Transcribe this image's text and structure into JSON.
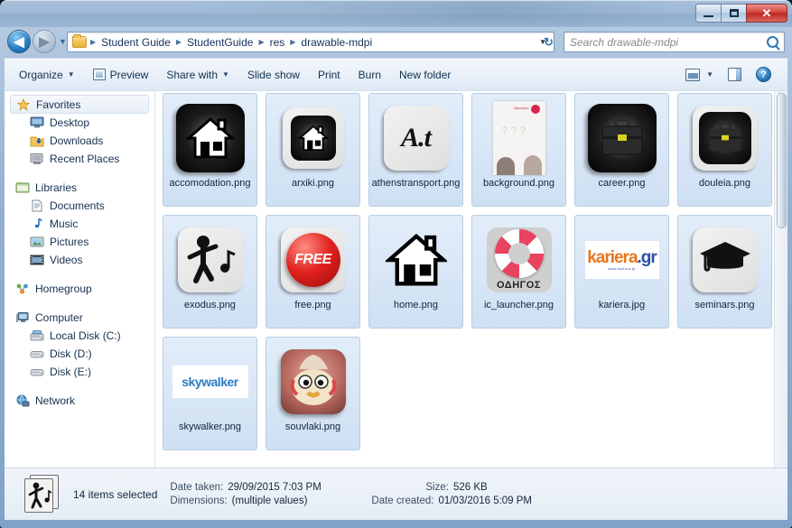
{
  "window": {
    "title": "",
    "controls": {
      "minimize": "minimize-button",
      "maximize": "maximize-button",
      "close": "✕"
    }
  },
  "address": {
    "back_icon": "◀",
    "forward_icon": "▶",
    "recent_caret": "▼",
    "breadcrumbs": [
      "Student Guide",
      "StudentGuide",
      "res",
      "drawable-mdpi"
    ],
    "separator": "▶",
    "dropdown_caret": "▼",
    "refresh_icon": "↻"
  },
  "search": {
    "placeholder": "Search drawable-mdpi",
    "value": "",
    "icon": "search-icon"
  },
  "toolbar": {
    "items": [
      {
        "label": "Organize",
        "caret": "▼",
        "icon": null
      },
      {
        "label": "Preview",
        "caret": null,
        "icon": "preview-icon"
      },
      {
        "label": "Share with",
        "caret": "▼",
        "icon": null
      },
      {
        "label": "Slide show",
        "caret": null,
        "icon": null
      },
      {
        "label": "Print",
        "caret": null,
        "icon": null
      },
      {
        "label": "Burn",
        "caret": null,
        "icon": null
      },
      {
        "label": "New folder",
        "caret": null,
        "icon": null
      }
    ],
    "right": {
      "view_caret": "▼",
      "help_label": "?"
    }
  },
  "sidebar": {
    "groups": [
      {
        "header": {
          "label": "Favorites",
          "icon": "star-icon",
          "selected": true
        },
        "items": [
          {
            "label": "Desktop",
            "icon": "desktop-icon"
          },
          {
            "label": "Downloads",
            "icon": "downloads-icon"
          },
          {
            "label": "Recent Places",
            "icon": "recent-places-icon"
          }
        ]
      },
      {
        "header": {
          "label": "Libraries",
          "icon": "libraries-icon",
          "selected": false
        },
        "items": [
          {
            "label": "Documents",
            "icon": "documents-icon"
          },
          {
            "label": "Music",
            "icon": "music-icon"
          },
          {
            "label": "Pictures",
            "icon": "pictures-icon"
          },
          {
            "label": "Videos",
            "icon": "videos-icon"
          }
        ]
      },
      {
        "header": {
          "label": "Homegroup",
          "icon": "homegroup-icon",
          "selected": false
        },
        "items": []
      },
      {
        "header": {
          "label": "Computer",
          "icon": "computer-icon",
          "selected": false
        },
        "items": [
          {
            "label": "Local Disk (C:)",
            "icon": "local-disk-icon"
          },
          {
            "label": "Disk (D:)",
            "icon": "drive-icon"
          },
          {
            "label": "Disk (E:)",
            "icon": "drive-icon"
          }
        ]
      },
      {
        "header": {
          "label": "Network",
          "icon": "network-icon",
          "selected": false
        },
        "items": []
      }
    ]
  },
  "files": [
    {
      "name": "accomodation.png",
      "thumb": "house-dark-icon",
      "selected": true
    },
    {
      "name": "arxiki.png",
      "thumb": "house-card-icon",
      "selected": true
    },
    {
      "name": "athenstransport.png",
      "thumb": "at-script-icon",
      "selected": true
    },
    {
      "name": "background.png",
      "thumb": "poster-photo-icon",
      "selected": true
    },
    {
      "name": "career.png",
      "thumb": "briefcase-dark-icon",
      "selected": true
    },
    {
      "name": "douleia.png",
      "thumb": "briefcase-card-icon",
      "selected": true
    },
    {
      "name": "exodus.png",
      "thumb": "dancer-icon",
      "selected": true
    },
    {
      "name": "free.png",
      "thumb": "free-badge-icon",
      "selected": true
    },
    {
      "name": "home.png",
      "thumb": "house-plain-icon",
      "selected": true
    },
    {
      "name": "ic_launcher.png",
      "thumb": "lifebuoy-odigos-icon",
      "selected": true
    },
    {
      "name": "kariera.jpg",
      "thumb": "kariera-logo-icon",
      "selected": true
    },
    {
      "name": "seminars.png",
      "thumb": "graduation-cap-icon",
      "selected": true
    },
    {
      "name": "skywalker.png",
      "thumb": "skywalker-logo-icon",
      "selected": true
    },
    {
      "name": "souvlaki.png",
      "thumb": "souvlaki-chicken-icon",
      "selected": true
    }
  ],
  "status": {
    "icon": "stacked-images-icon",
    "selection": "14 items selected",
    "details": [
      {
        "label": "Date taken:",
        "value": "29/09/2015 7:03 PM"
      },
      {
        "label": "Dimensions:",
        "value": "(multiple values)"
      },
      {
        "label": "Size:",
        "value": "526 KB"
      },
      {
        "label": "Date created:",
        "value": "01/03/2016 5:09 PM"
      }
    ]
  },
  "logos": {
    "kariera_main": "kariera",
    "kariera_suffix": ".gr",
    "kariera_tagline": "www.kariera.gr",
    "skywalker_main": "skywalker",
    "free_text": "FREE",
    "odigos_text": "ΟΔΗΓΟΣ",
    "at_text": "A.t"
  },
  "colors": {
    "selection": "#cfe0f3",
    "accent": "#2f77b5",
    "close_red": "#d4473f"
  }
}
